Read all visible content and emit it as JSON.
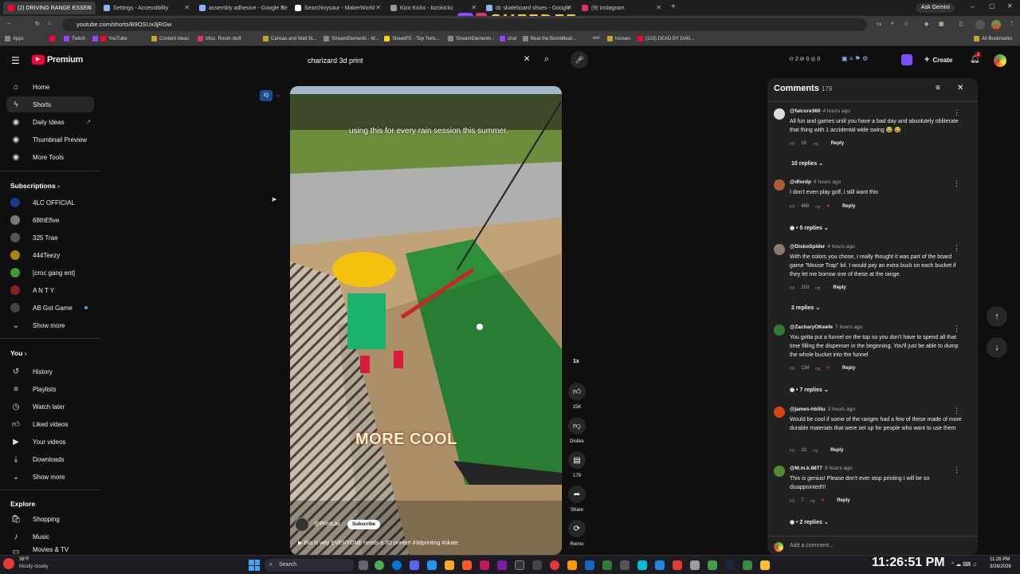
{
  "browser": {
    "tabs": [
      {
        "title": "(2) DRIVING RANGE ESSEN",
        "color": "#ff0033"
      },
      {
        "title": "Settings - Accessibility",
        "color": "#8ab4f8"
      },
      {
        "title": "assembly adhesive - Google Se",
        "color": "#8ab4f8"
      },
      {
        "title": "Searchivysaur - MakerWorld",
        "color": "#ffffff"
      },
      {
        "title": "Kizo Kicks - kizokicks",
        "color": "#999999"
      },
      {
        "title": "dc skateboard shoes - Google",
        "color": "#8ab4f8"
      },
      {
        "title": "(9) Instagram",
        "color": "#e1306c"
      }
    ],
    "url": "youtube.com/shorts/B9OSUx3jRGw",
    "ask_gemini": "Ask Gemini",
    "bookmarks": [
      "Apps",
      "Twitch",
      "YouTube",
      "Content Ideas",
      "Misc. Room stuff",
      "Canvas and Wall St...",
      "StreamElements - M...",
      "SheedFE - Top Twitc...",
      "StreamElements -",
      "chat",
      "Beat the BombBeat...",
      "oor",
      "houses",
      "(103) DEAD BY DAN..."
    ],
    "all_bookmarks": "All Bookmarks"
  },
  "overlay": {
    "brand": "SHEEDFE"
  },
  "youtube": {
    "logo": "Premium",
    "search_value": "charizard 3d print",
    "create_label": "Create",
    "notif_count": "2",
    "counters": {
      "a": "2",
      "b": "0",
      "c": "0"
    },
    "sidebar": {
      "main": [
        {
          "label": "Home",
          "icon": "home-icon"
        },
        {
          "label": "Shorts",
          "icon": "shorts-icon"
        },
        {
          "label": "Daily Ideas",
          "icon": "ideas-icon"
        },
        {
          "label": "Thumbnail Preview",
          "icon": "thumbnail-icon"
        },
        {
          "label": "More Tools",
          "icon": "tools-icon"
        }
      ],
      "subscriptions_head": "Subscriptions",
      "subscriptions": [
        {
          "label": "4LC OFFICIAL",
          "color": "#1a3a8a"
        },
        {
          "label": "68thEfive",
          "color": "#777777"
        },
        {
          "label": "325 Trae",
          "color": "#555555"
        },
        {
          "label": "444Teezy",
          "color": "#aa8800"
        },
        {
          "label": "[croc gang ent]",
          "color": "#3c9a3c"
        },
        {
          "label": "A N T Y",
          "color": "#882222"
        },
        {
          "label": "AB Got Game",
          "color": "#444444"
        },
        {
          "label": "Show more",
          "color": ""
        }
      ],
      "you_head": "You",
      "you": [
        {
          "label": "History",
          "icon": "history-icon"
        },
        {
          "label": "Playlists",
          "icon": "playlists-icon"
        },
        {
          "label": "Watch later",
          "icon": "watch-later-icon"
        },
        {
          "label": "Liked videos",
          "icon": "liked-icon"
        },
        {
          "label": "Your videos",
          "icon": "your-videos-icon"
        },
        {
          "label": "Downloads",
          "icon": "downloads-icon"
        },
        {
          "label": "Show more",
          "icon": "chevron-down-icon"
        }
      ],
      "explore_head": "Explore",
      "explore": [
        {
          "label": "Shopping",
          "icon": "shopping-icon"
        },
        {
          "label": "Music",
          "icon": "music-icon"
        },
        {
          "label": "Movies & TV",
          "icon": "movies-icon"
        }
      ]
    },
    "video": {
      "caption": "using this for every rain session this summer.",
      "overlay_text": "MORE COOL",
      "channel": "@PrintLair",
      "subscribe": "Subscribe",
      "title": "this is why EVERYONE needs a 3D printer! #3dprinting #skate",
      "speed": "1x"
    },
    "actions": {
      "likes": "15K",
      "dislike": "Dislike",
      "comments": "179",
      "share": "Share",
      "remix": "Remix"
    },
    "comments": {
      "title": "Comments",
      "count": "179",
      "add_placeholder": "Add a comment...",
      "items": [
        {
          "author": "@falcore360",
          "time": "4 hours ago",
          "text": "All fun and games until you have a bad day and absolutely obliterate that thing with 1 accidental wide swing 😂 😂",
          "likes": "1K",
          "replies": "10 replies",
          "color": "#dddddd"
        },
        {
          "author": "@dfordp",
          "time": "8 hours ago",
          "text": "I don't even play golf, i still want this",
          "likes": "468",
          "replies": "5 replies",
          "color": "#b05a3a"
        },
        {
          "author": "@DiskoSpider",
          "time": "4 hours ago",
          "text": "With the colors you chose, I really thought it was part of the board game \"Mouse Trap\" lol. I would pay an extra buck on each bucket if they let me borrow one of these at the range.",
          "likes": "203",
          "replies": "2 replies",
          "color": "#8a7a6a"
        },
        {
          "author": "@ZacharyOKeefe",
          "time": "7 hours ago",
          "text": "You gotta put a funnel on the top so you don't have to spend all that time filling the dispenser in the beginning. You'll just be able to dump the whole bucket into the funnel",
          "likes": "134",
          "replies": "7 replies",
          "color": "#2e7d32"
        },
        {
          "author": "@james-hb5tu",
          "time": "3 hours ago",
          "text": "Would be cool if some of the ranges had a few of these made of more durable materials that were set up for people who want to use them",
          "likes": "19",
          "replies": "",
          "color": "#d84315"
        },
        {
          "author": "@M.m.k.8877",
          "time": "9 hours ago",
          "text": "This is genius! Please don't ever stop printing I will be so disappointed!!!",
          "likes": "7",
          "replies": "2 replies",
          "color": "#558b2f"
        }
      ],
      "reply_label": "Reply"
    }
  },
  "taskbar": {
    "weather_temp": "38°F",
    "weather_desc": "Mostly cloudy",
    "search_label": "Search",
    "clock_big": "11:26:51 PM",
    "clock_time": "11:26 PM",
    "clock_date": "3/28/2026"
  }
}
